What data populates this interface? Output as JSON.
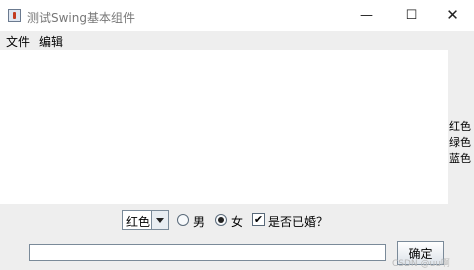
{
  "window": {
    "title": "测试Swing基本组件",
    "minimize_glyph": "—",
    "maximize_glyph": "☐",
    "close_glyph": "✕"
  },
  "menu": {
    "items": [
      {
        "label": "文件"
      },
      {
        "label": "编辑"
      }
    ]
  },
  "text_area": {
    "value": ""
  },
  "color_list": {
    "items": [
      "红色",
      "绿色",
      "蓝色"
    ]
  },
  "controls": {
    "color_combo": {
      "selected": "红色"
    },
    "gender": {
      "options": [
        {
          "label": "男",
          "checked": false
        },
        {
          "label": "女",
          "checked": true
        }
      ]
    },
    "married": {
      "label": "是否已婚？",
      "checked": true,
      "check_glyph": "✔"
    }
  },
  "bottom": {
    "text_field_value": "",
    "ok_label": "确定"
  },
  "watermark": "CSDN @uu啊"
}
